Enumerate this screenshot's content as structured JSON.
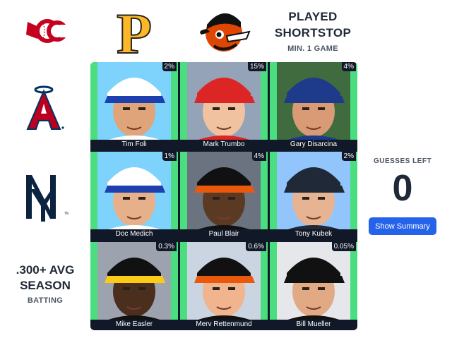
{
  "columns": [
    {
      "logo_icon": "cincinnati-reds-logo-icon",
      "colors": {
        "primary": "#c6011f"
      }
    },
    {
      "logo_icon": "pittsburgh-pirates-logo-icon",
      "text": "P",
      "colors": {
        "primary": "#fdb827",
        "outline": "#27251f"
      }
    },
    {
      "logo_icon": "baltimore-orioles-logo-icon",
      "colors": {
        "primary": "#df4601",
        "secondary": "#000000"
      }
    },
    {
      "title_line1": "PLAYED",
      "title_line2": "SHORTSTOP",
      "subtitle": "MIN. 1 GAME"
    }
  ],
  "rows": [
    {
      "logo_icon": "los-angeles-angels-logo-icon",
      "text": "A",
      "colors": {
        "primary": "#ba0021",
        "secondary": "#003263"
      }
    },
    {
      "logo_icon": "new-york-yankees-logo-icon",
      "text": "NY",
      "colors": {
        "primary": "#0c2340"
      }
    },
    {
      "title_line1": ".300+ AVG",
      "title_line2": "SEASON",
      "subtitle": "BATTING"
    }
  ],
  "cells": [
    {
      "name": "Tim Foli",
      "pct": "2%",
      "cap_color": "#ffffff",
      "cap_bill": "#1e40af",
      "skin": "#e0a47a",
      "bg": "#7dd3fc"
    },
    {
      "name": "Mark Trumbo",
      "pct": "15%",
      "cap_color": "#dc2626",
      "cap_bill": "#dc2626",
      "skin": "#f1c2a0",
      "bg": "#94a3b8"
    },
    {
      "name": "Gary Disarcina",
      "pct": "4%",
      "cap_color": "#1e3a8a",
      "cap_bill": "#1e3a8a",
      "skin": "#d99b76",
      "bg": "#3f6b3f"
    },
    {
      "name": "Doc Medich",
      "pct": "1%",
      "cap_color": "#ffffff",
      "cap_bill": "#1e40af",
      "skin": "#e6b08a",
      "bg": "#7dd3fc"
    },
    {
      "name": "Paul Blair",
      "pct": "4%",
      "cap_color": "#111111",
      "cap_bill": "#ea580c",
      "skin": "#5b3a24",
      "bg": "#6b7280"
    },
    {
      "name": "Tony Kubek",
      "pct": "2%",
      "cap_color": "#1f2937",
      "cap_bill": "#1f2937",
      "skin": "#e7b493",
      "bg": "#93c5fd"
    },
    {
      "name": "Mike Easler",
      "pct": "0.3%",
      "cap_color": "#111111",
      "cap_bill": "#facc15",
      "skin": "#4a2e1e",
      "bg": "#9ca3af"
    },
    {
      "name": "Merv Rettenmund",
      "pct": "0.6%",
      "cap_color": "#111111",
      "cap_bill": "#ea580c",
      "skin": "#f0b48e",
      "bg": "#cbd5e1"
    },
    {
      "name": "Bill Mueller",
      "pct": "0.05%",
      "cap_color": "#111111",
      "cap_bill": "#111111",
      "skin": "#e2a985",
      "bg": "#e5e7eb"
    }
  ],
  "guesses": {
    "label": "GUESSES LEFT",
    "count": "0"
  },
  "buttons": {
    "show_summary": "Show Summary"
  },
  "colors": {
    "correct_cell": "#4ade80",
    "grid_frame": "#111827",
    "button": "#2563eb"
  }
}
